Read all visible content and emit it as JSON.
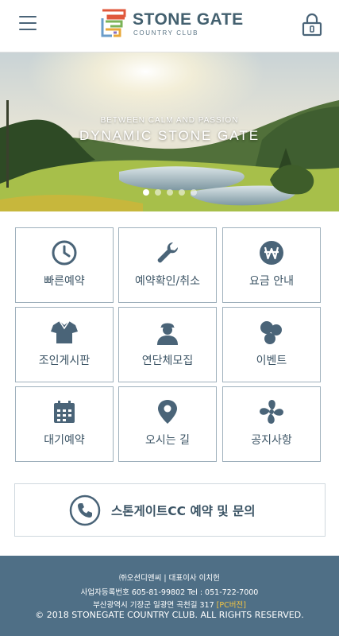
{
  "header": {
    "logo_title": "STONE GATE",
    "logo_subtitle": "COUNTRY CLUB"
  },
  "hero": {
    "kicker": "BETWEEN CALM AND PASSION",
    "title": "DYNAMIC STONE GATE",
    "slide_count": 5,
    "active_slide": 1
  },
  "menu": {
    "items": [
      {
        "label": "빠른예약",
        "icon": "clock-icon"
      },
      {
        "label": "예약확인/취소",
        "icon": "wrench-icon"
      },
      {
        "label": "요금 안내",
        "icon": "won-icon"
      },
      {
        "label": "조인게시판",
        "icon": "shirt-icon"
      },
      {
        "label": "연단체모집",
        "icon": "person-icon"
      },
      {
        "label": "이벤트",
        "icon": "circles-icon"
      },
      {
        "label": "대기예약",
        "icon": "calendar-icon"
      },
      {
        "label": "오시는 길",
        "icon": "map-pin-icon"
      },
      {
        "label": "공지사항",
        "icon": "fan-icon"
      }
    ]
  },
  "call": {
    "label": "스톤게이트CC 예약 및 문의"
  },
  "footer": {
    "company": "㈜오션디앤씨 | 대표이사 이치헌",
    "biz": "사업자등록번호 605-81-99802 Tel : 051-722-7000",
    "address": "부산광역시 기장군 일광면 곡천길 317",
    "pc_link": "[PC버전]",
    "copyright": "© 2018 STONEGATE COUNTRY CLUB. ALL RIGHTS RESERVED."
  },
  "colors": {
    "accent": "#4f6f86",
    "icon": "#4a6478",
    "pc_link": "#f4c542"
  }
}
